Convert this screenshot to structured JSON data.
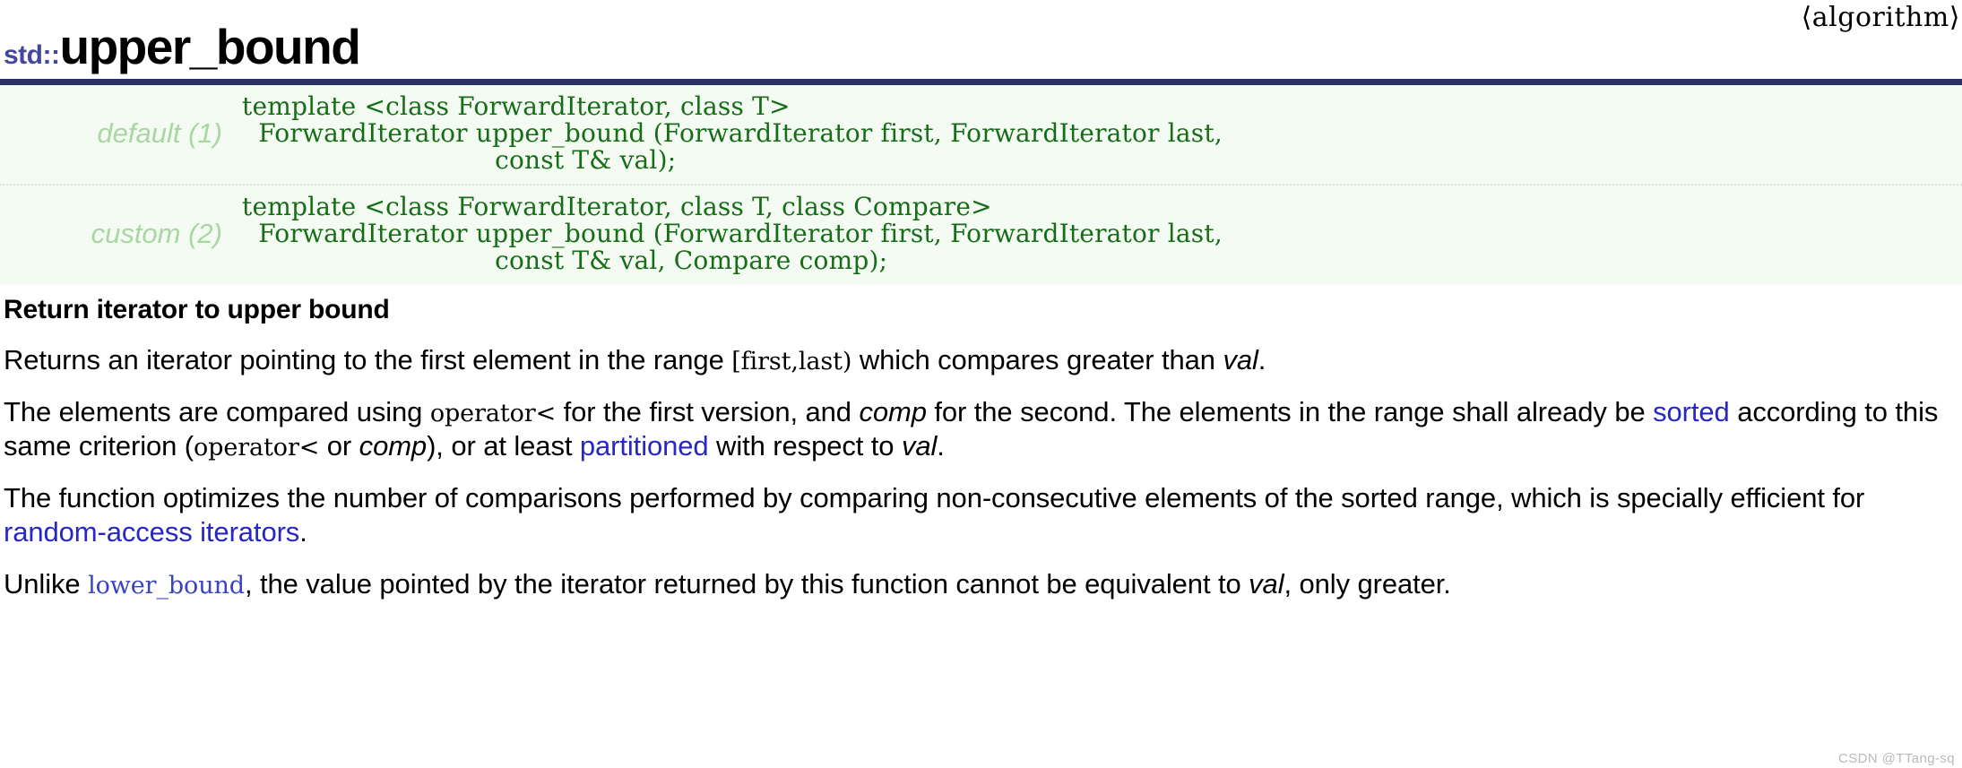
{
  "header": {
    "namespace": "std::",
    "function_name": "upper_bound",
    "include_header": "⟨algorithm⟩"
  },
  "signatures": [
    {
      "label": "default (1)",
      "code": "template <class ForwardIterator, class T>\n  ForwardIterator upper_bound (ForwardIterator first, ForwardIterator last,\n                               const T& val);"
    },
    {
      "label": "custom (2)",
      "code": "template <class ForwardIterator, class T, class Compare>\n  ForwardIterator upper_bound (ForwardIterator first, ForwardIterator last,\n                               const T& val, Compare comp);"
    }
  ],
  "description": {
    "heading": "Return iterator to upper bound",
    "p1": {
      "t1": "Returns an iterator pointing to the first element in the range ",
      "code1": "[first,last)",
      "t2": " which compares greater than ",
      "em1": "val",
      "t3": "."
    },
    "p2": {
      "t1": "The elements are compared using ",
      "code1": "operator<",
      "t2": " for the first version, and ",
      "em1": "comp",
      "t3": " for the second. The elements in the range shall already be ",
      "link1": "sorted",
      "t4": " according to this same criterion (",
      "code2": "operator<",
      "t5": " or ",
      "em2": "comp",
      "t6": "), or at least ",
      "link2": "partitioned",
      "t7": " with respect to ",
      "em3": "val",
      "t8": "."
    },
    "p3": {
      "t1": "The function optimizes the number of comparisons performed by comparing non-consecutive elements of the sorted range, which is specially efficient for ",
      "link1": "random-access iterators",
      "t2": "."
    },
    "p4": {
      "t1": "Unlike ",
      "code1": "lower_bound",
      "t2": ", the value pointed by the iterator returned by this function cannot be equivalent to ",
      "em1": "val",
      "t3": ", only greater."
    }
  },
  "watermark": "CSDN @TTang-sq",
  "colors": {
    "rule": "#2c3268",
    "namespace": "#44489c",
    "sig_background": "#f4fbf2",
    "sig_label": "#a9d6a3",
    "sig_code": "#176d17",
    "link": "#2727c4",
    "mono_link": "#3a42c4"
  }
}
